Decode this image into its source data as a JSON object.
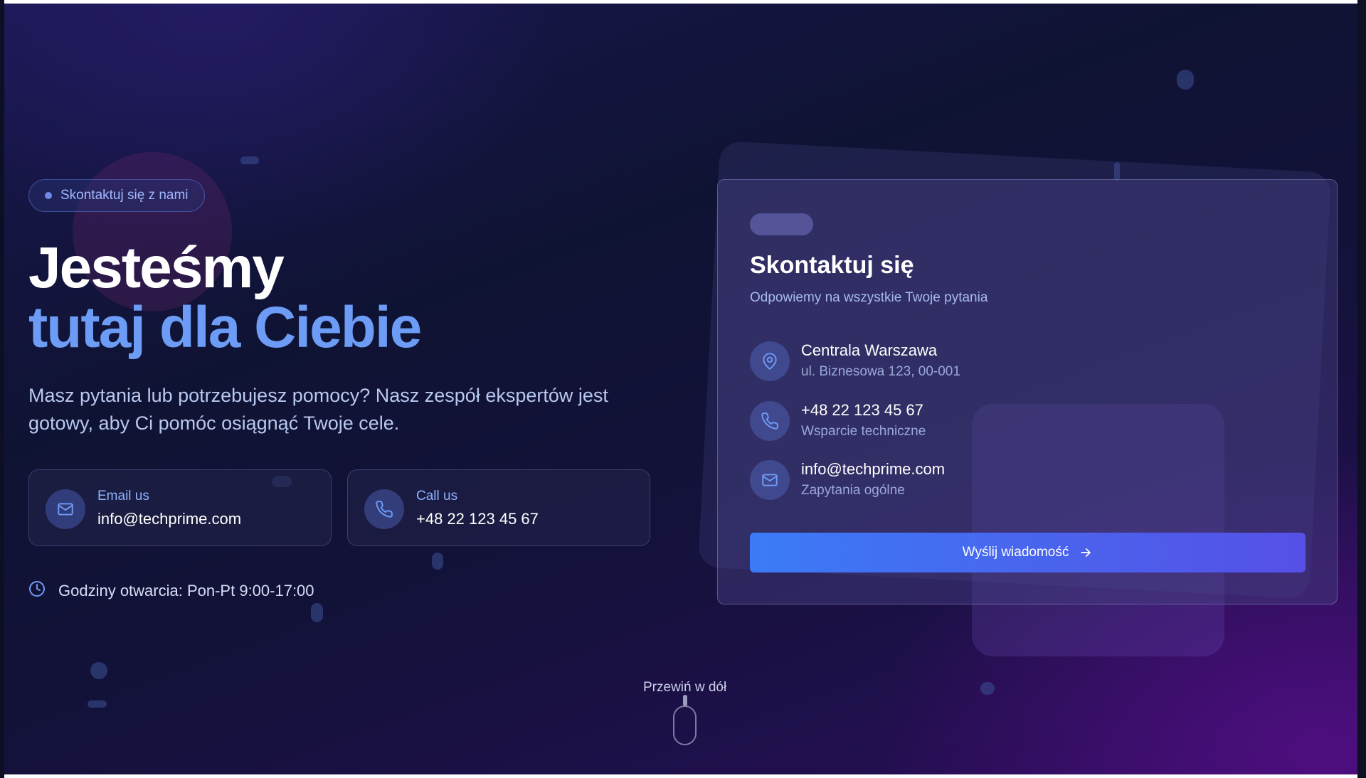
{
  "badge": {
    "label": "Skontaktuj się z nami"
  },
  "hero": {
    "title_line1": "Jesteśmy",
    "title_line2": "tutaj dla Ciebie",
    "subtitle": "Masz pytania lub potrzebujesz pomocy? Nasz zespół ekspertów jest gotowy, aby Ci pomóc osiągnąć Twoje cele."
  },
  "quick_contacts": [
    {
      "label": "Email us",
      "value": "info@techprime.com",
      "icon": "mail-icon"
    },
    {
      "label": "Call us",
      "value": "+48 22 123 45 67",
      "icon": "phone-icon"
    }
  ],
  "hours": {
    "text": "Godziny otwarcia: Pon-Pt 9:00-17:00",
    "icon": "clock-icon"
  },
  "contact_panel": {
    "title": "Skontaktuj się",
    "subtitle": "Odpowiemy na wszystkie Twoje pytania",
    "rows": [
      {
        "main": "Centrala Warszawa",
        "sub": "ul. Biznesowa 123, 00-001",
        "icon": "map-pin-icon"
      },
      {
        "main": "+48 22 123 45 67",
        "sub": "Wsparcie techniczne",
        "icon": "phone-icon"
      },
      {
        "main": "info@techprime.com",
        "sub": "Zapytania ogólne",
        "icon": "mail-icon"
      }
    ],
    "button_label": "Wyślij wiadomość"
  },
  "scroll_hint": {
    "label": "Przewiń w dół"
  },
  "colors": {
    "accent": "#6c9cf6",
    "button_start": "#3b7bf6",
    "button_end": "#5650e6"
  }
}
